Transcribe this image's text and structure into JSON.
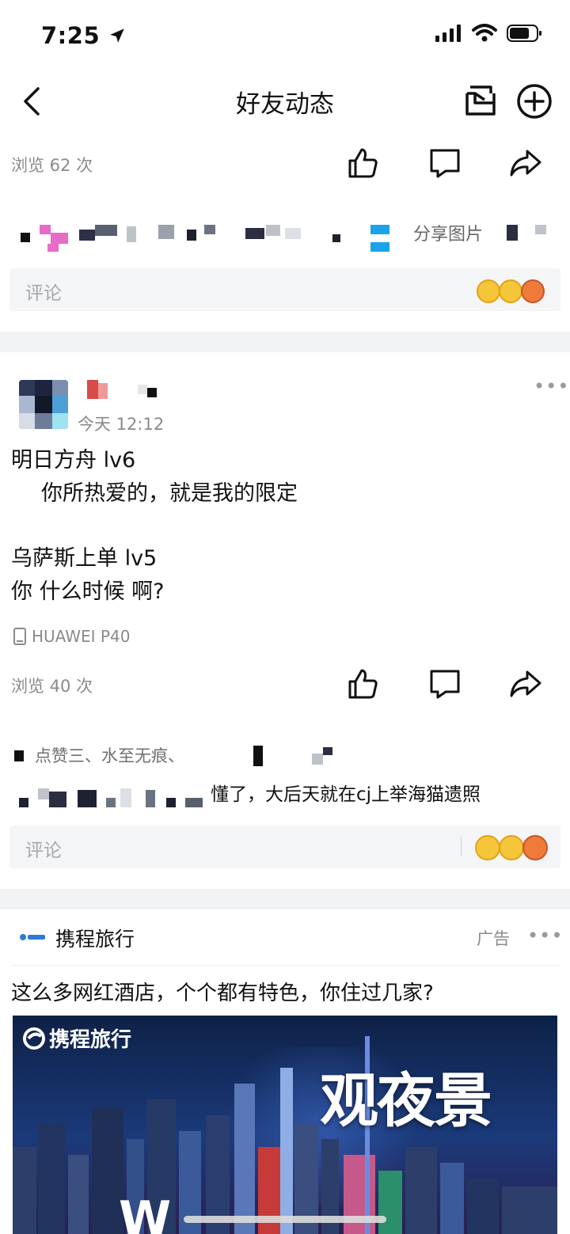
{
  "status": {
    "time": "7:25"
  },
  "nav": {
    "title": "好友动态"
  },
  "post1": {
    "views": "浏览 62 次",
    "comment_snippet": "分享图片",
    "comment_placeholder": "评论"
  },
  "post2": {
    "time": "今天 12:12",
    "lines": [
      "明日方舟  lv6",
      "你所热爱的，就是我的限定",
      "乌萨斯上单  lv5",
      "你   什么时候   啊?"
    ],
    "device": "HUAWEI P40",
    "views": "浏览 40 次",
    "comment1": "点赞三、水至无痕、",
    "comment2": "懂了，大后天就在cj上举海猫遗照",
    "comment_placeholder": "评论"
  },
  "ad": {
    "brand": "携程旅行",
    "tag": "广告",
    "headline": "这么多网红酒店，个个都有特色，你住过几家?",
    "image_logo": "携程旅行",
    "image_slogan": "观夜景",
    "image_partial": "W"
  },
  "colors": {
    "accent_blue": "#1aa3e8",
    "ad_text": "#ffffff"
  }
}
